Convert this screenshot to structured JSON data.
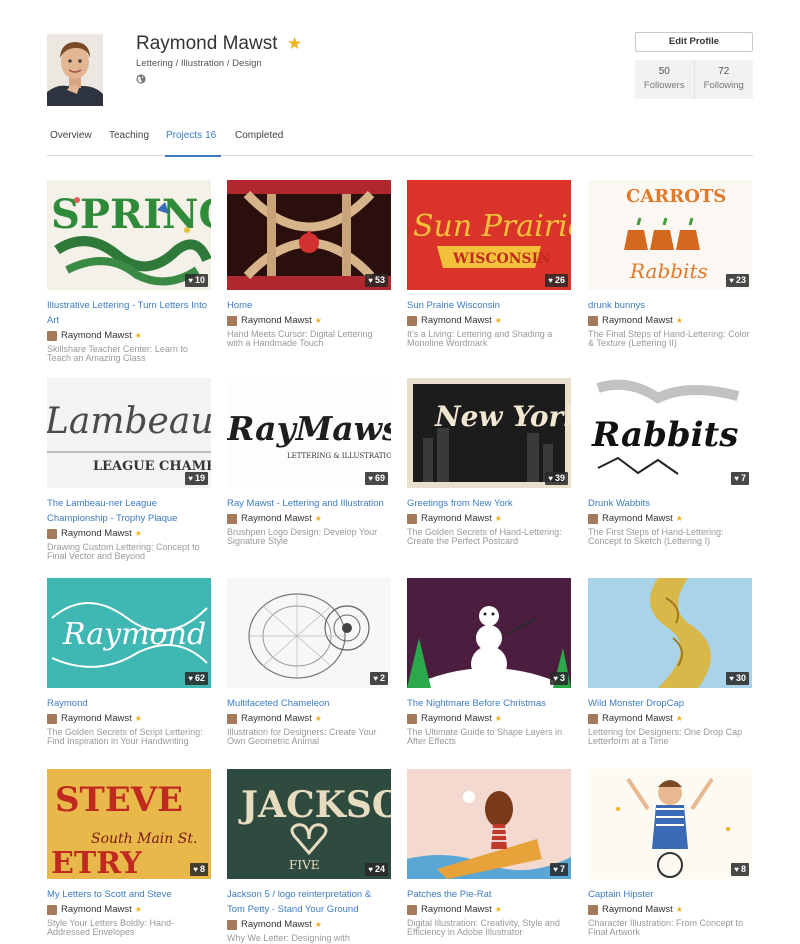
{
  "profile": {
    "name": "Raymond Mawst",
    "tagline": "Lettering / Illustration / Design",
    "edit_label": "Edit Profile",
    "followers_count": "50",
    "followers_label": "Followers",
    "following_count": "72",
    "following_label": "Following"
  },
  "tabs": {
    "overview": "Overview",
    "teaching": "Teaching",
    "projects": "Projects",
    "projects_count": "16",
    "completed": "Completed"
  },
  "colors": {
    "accent": "#3d7cc0",
    "star": "#f2b21d"
  },
  "projects": [
    {
      "title": "Illustrative Lettering - Turn Letters Into Art",
      "author": "Raymond Mawst",
      "course": "Skillshare Teacher Center: Learn to Teach an Amazing Class",
      "likes": "10",
      "art": "SPRING"
    },
    {
      "title": "Home",
      "author": "Raymond Mawst",
      "course": "Hand Meets Cursor: Digital Lettering with a Handmade Touch",
      "likes": "53",
      "art": ""
    },
    {
      "title": "Sun Prairie Wisconsin",
      "author": "Raymond Mawst",
      "course": "It's a Living: Lettering and Shading a Monoline Wordmark",
      "likes": "26",
      "art": "Sun Prairie"
    },
    {
      "title": "drunk bunnys",
      "author": "Raymond Mawst",
      "course": "The Final Steps of Hand-Lettering: Color & Texture (Lettering II)",
      "likes": "23",
      "art": "CARROTS"
    },
    {
      "title": "The Lambeau-ner League Championship - Trophy Plaque",
      "author": "Raymond Mawst",
      "course": "Drawing Custom Lettering: Concept to Final Vector and Beyond",
      "likes": "19",
      "art": "Lambeaune"
    },
    {
      "title": "Ray Mawst - Lettering and Illustration",
      "author": "Raymond Mawst",
      "course": "Brushpen Logo Design: Develop Your Signature Style",
      "likes": "69",
      "art": "RayMawst"
    },
    {
      "title": "Greetings from New York",
      "author": "Raymond Mawst",
      "course": "The Golden Secrets of Hand-Lettering: Create the Perfect Postcard",
      "likes": "39",
      "art": "New York"
    },
    {
      "title": "Drunk Wabbits",
      "author": "Raymond Mawst",
      "course": "The First Steps of Hand-Lettering: Concept to Sketch (Lettering I)",
      "likes": "7",
      "art": "Rabbits"
    },
    {
      "title": "Raymond",
      "author": "Raymond Mawst",
      "course": "The Golden Secrets of Script Lettering: Find Inspiration in Your Handwriting",
      "likes": "62",
      "art": "Raymond"
    },
    {
      "title": "Multifaceted Chameleon",
      "author": "Raymond Mawst",
      "course": "Illustration for Designers: Create Your Own Geometric Animal",
      "likes": "2",
      "art": ""
    },
    {
      "title": "The Nightmare Before Christmas",
      "author": "Raymond Mawst",
      "course": "The Ultimate Guide to Shape Layers in After Effects",
      "likes": "3",
      "art": ""
    },
    {
      "title": "Wild Monster DropCap",
      "author": "Raymond Mawst",
      "course": "Lettering for Designers: One Drop Cap Letterform at a Time",
      "likes": "30",
      "art": ""
    },
    {
      "title": "My Letters to Scott and Steve",
      "author": "Raymond Mawst",
      "course": "Style Your Letters Boldly: Hand-Addressed Envelopes",
      "likes": "8",
      "art": "STEVE"
    },
    {
      "title": "Jackson 5 / logo reinterpretation & Tom Petty - Stand Your Ground",
      "author": "Raymond Mawst",
      "course": "Why We Letter: Designing with",
      "likes": "24",
      "art": "JACKSON"
    },
    {
      "title": "Patches the Pie-Rat",
      "author": "Raymond Mawst",
      "course": "Digital Illustration: Creativity, Style and Efficiency in Adobe Illustrator",
      "likes": "7",
      "art": ""
    },
    {
      "title": "Captain Hipster",
      "author": "Raymond Mawst",
      "course": "Character Illustration: From Concept to Final Artwork",
      "likes": "8",
      "art": ""
    }
  ]
}
